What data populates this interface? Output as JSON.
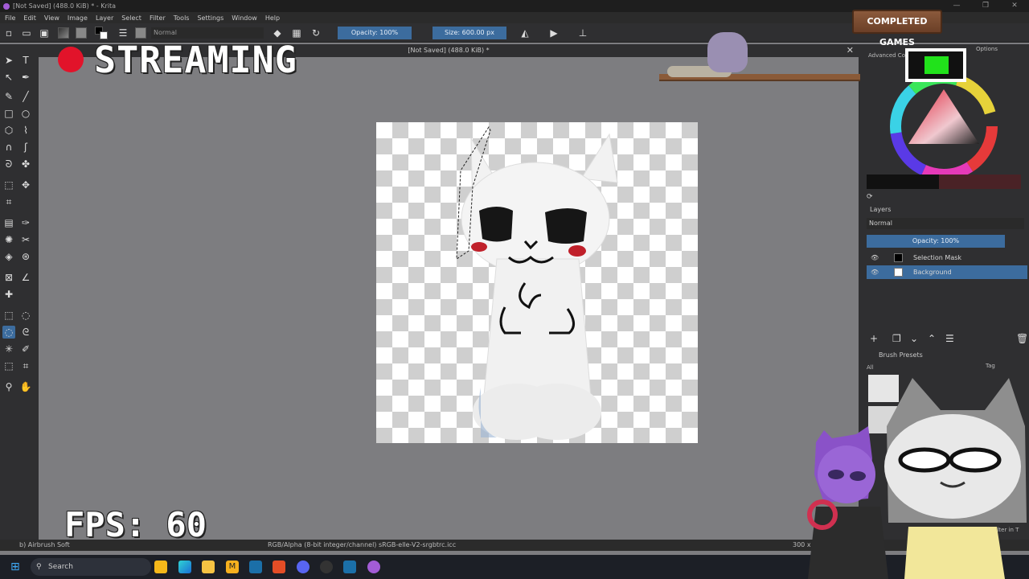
{
  "window": {
    "title": "[Not Saved]  (488.0 KiB) * - Krita",
    "controls": [
      "—",
      "❐",
      "✕"
    ]
  },
  "menu": [
    "File",
    "Edit",
    "View",
    "Image",
    "Layer",
    "Select",
    "Filter",
    "Tools",
    "Settings",
    "Window",
    "Help"
  ],
  "toolbar": {
    "blend_mode": "Normal",
    "opacity": "Opacity: 100%",
    "size": "Size: 600.00 px",
    "fg_color": "#000000",
    "bg_color": "#ffffff"
  },
  "document": {
    "tab_title": "[Not Saved]  (488.0 KiB) *",
    "close": "✕"
  },
  "dock": {
    "advanced_color_selector": "Advanced Color Selector",
    "options": "Options",
    "layers_title": "Layers",
    "layers_blend": "Normal",
    "layers_opacity": "Opacity:  100%",
    "layers": [
      {
        "name": "Selection Mask",
        "selected": false
      },
      {
        "name": "Background",
        "selected": true
      }
    ],
    "brush_presets_title": "Brush Presets",
    "brush_filter": "All",
    "brush_tag": "Tag",
    "filter_in_tag": "Filter in T"
  },
  "status": {
    "brush": "b) Airbrush Soft",
    "color_profile": "RGB/Alpha (8-bit integer/channel)  sRGB-elle-V2-srgbtrc.icc",
    "image_size": "300 x 30"
  },
  "overlay": {
    "streaming": "STREAMING",
    "fps": "FPS: 60",
    "completed_games": "COMPLETED GAMES",
    "live_color": "#e2132a",
    "badge_color": "#21e21b"
  },
  "taskbar": {
    "search_placeholder": "Search"
  },
  "colors": {
    "accent": "#3c6c9e",
    "panel": "#2f2f31",
    "canvas_bg": "#7d7d80"
  }
}
